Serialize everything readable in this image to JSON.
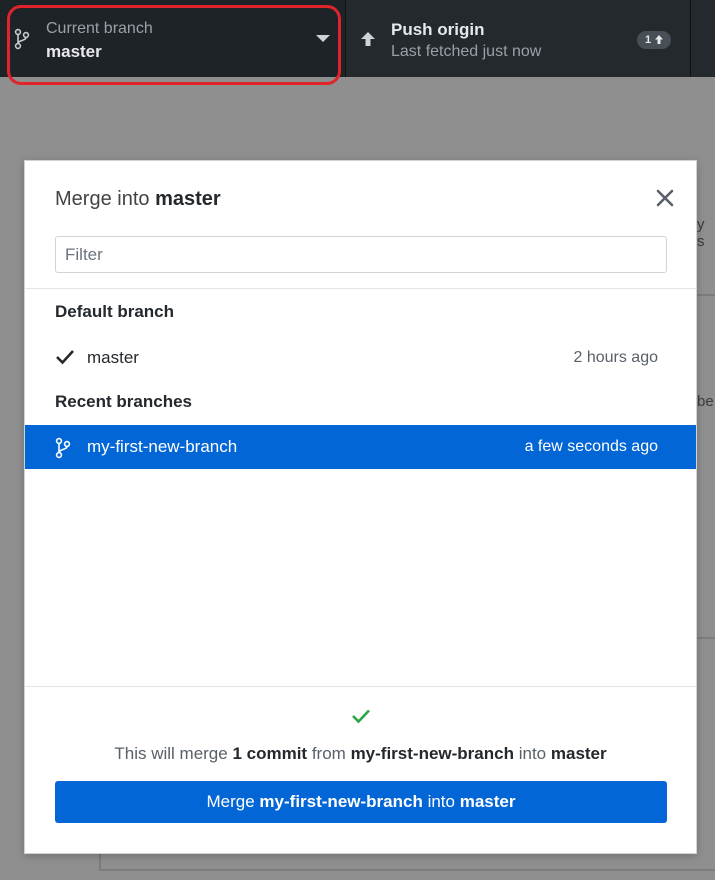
{
  "toolbar": {
    "branch": {
      "label": "Current branch",
      "value": "master",
      "icon": "git-branch-icon"
    },
    "push": {
      "label": "Push origin",
      "value": "Last fetched just now",
      "badge": "1",
      "icon": "arrow-up-icon"
    }
  },
  "background": {
    "snippet_1": "y s",
    "snippet_2": "be"
  },
  "modal": {
    "title_prefix": "Merge into",
    "title_branch": "master",
    "filter_placeholder": "Filter",
    "default_section": "Default branch",
    "default_branches": [
      {
        "name": "master",
        "time": "2 hours ago",
        "icon": "check-icon"
      }
    ],
    "recent_section": "Recent branches",
    "recent_branches": [
      {
        "name": "my-first-new-branch",
        "time": "a few seconds ago",
        "icon": "git-branch-icon",
        "selected": true
      }
    ],
    "footer": {
      "prefix": "This will merge",
      "count": "1 commit",
      "from_word": "from",
      "source": "my-first-new-branch",
      "into_word": "into",
      "target": "master"
    },
    "merge_button": {
      "prefix": "Merge",
      "source": "my-first-new-branch",
      "into_word": "into",
      "target": "master"
    }
  },
  "colors": {
    "accent": "#0366d6",
    "success": "#28a745",
    "highlight": "#e0242b",
    "toolbar": "#24292e"
  }
}
